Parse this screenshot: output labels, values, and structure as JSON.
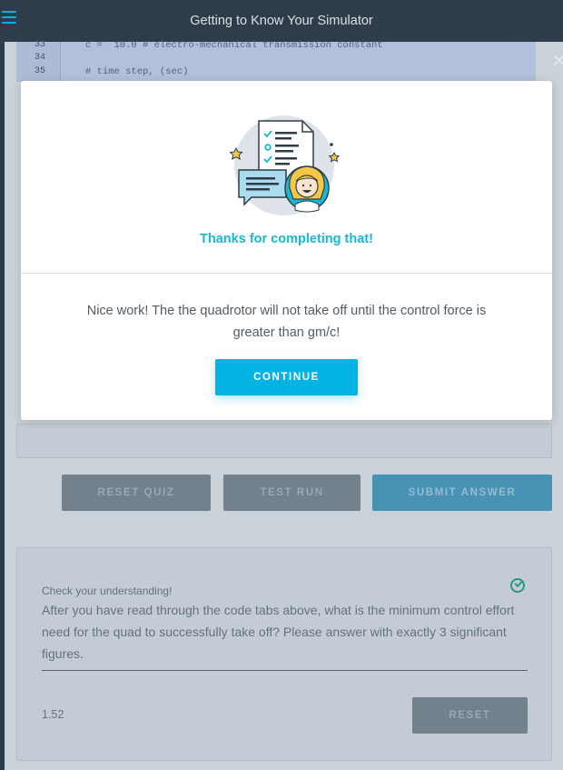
{
  "header": {
    "title": "Getting to Know Your Simulator"
  },
  "code": {
    "lines": [
      {
        "num": "33",
        "text": "c =  10.0 # electro-mechanical transmission constant"
      },
      {
        "num": "34",
        "text": ""
      },
      {
        "num": "35",
        "text": "# time step, (sec)"
      }
    ]
  },
  "quiz_buttons": {
    "reset_quiz": "RESET QUIZ",
    "test_run": "TEST RUN",
    "submit_answer": "SUBMIT ANSWER"
  },
  "question_card": {
    "label": "Check your understanding!",
    "question": "After you have read through the code tabs above, what is the minimum control effort need for the quad to successfully take off? Please answer with exactly 3 significant figures.",
    "answer": "1.52",
    "reset_label": "RESET"
  },
  "modal": {
    "heading": "Thanks for completing that!",
    "message": "Nice work! The the quadrotor will not take off until the control force is greater than gm/c!",
    "continue_label": "CONTINUE",
    "close_glyph": "×"
  },
  "colors": {
    "topbar": "#2e3d49",
    "accent": "#02b3e4",
    "heading": "#16b9d1",
    "success": "#2aa58b"
  }
}
